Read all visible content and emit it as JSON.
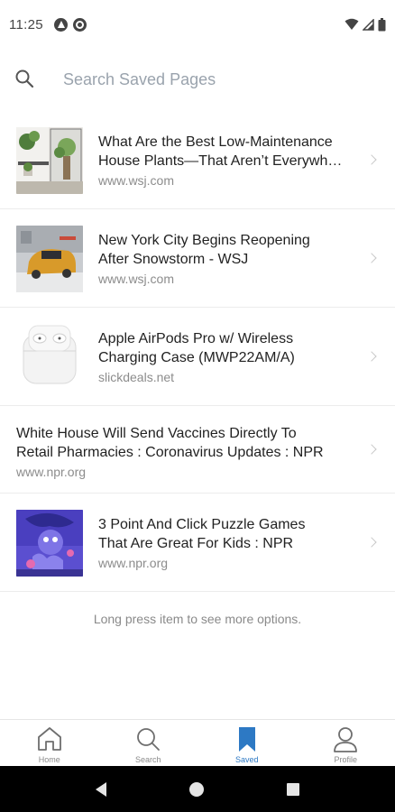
{
  "status_bar": {
    "time": "11:25",
    "left_icons": [
      "app-notification-icon",
      "data-saver-icon"
    ],
    "right_icons": [
      "wifi-icon",
      "signal-icon",
      "battery-icon"
    ]
  },
  "search": {
    "placeholder": "Search Saved Pages",
    "value": ""
  },
  "items": [
    {
      "title": "What Are the Best Low-Maintenance House Plants—That Aren’t Everywh…",
      "title_line1": "What Are the Best Low-Maintenance",
      "title_line2": "House Plants—That Aren’t Everywh…",
      "domain": "www.wsj.com",
      "thumbnail": "house-plants"
    },
    {
      "title": "New York City Begins Reopening After Snowstorm - WSJ",
      "title_line1": "New York City Begins Reopening",
      "title_line2": "After Snowstorm - WSJ",
      "domain": "www.wsj.com",
      "thumbnail": "taxi-snow"
    },
    {
      "title": "Apple AirPods Pro w/ Wireless Charging Case (MWP22AM/A)",
      "title_line1": "Apple AirPods Pro w/ Wireless",
      "title_line2": "Charging Case (MWP22AM/A)",
      "domain": "slickdeals.net",
      "thumbnail": "airpods"
    },
    {
      "title": "White House Will Send Vaccines Directly To Retail Pharmacies : Coronavirus Updates : NPR",
      "title_line1": "White House Will Send Vaccines Directly To",
      "title_line2": "Retail Pharmacies : Coronavirus Updates : NPR",
      "domain": "www.npr.org",
      "thumbnail": null
    },
    {
      "title": "3 Point And Click Puzzle Games That Are Great For Kids : NPR",
      "title_line1": "3 Point And Click Puzzle Games",
      "title_line2": "That Are Great For Kids : NPR",
      "domain": "www.npr.org",
      "thumbnail": "puzzle-game"
    }
  ],
  "hint": "Long press item to see more options.",
  "bottom_nav": [
    {
      "label": "Home",
      "icon": "home-icon",
      "active": false
    },
    {
      "label": "Search",
      "icon": "search-icon",
      "active": false
    },
    {
      "label": "Saved",
      "icon": "bookmark-icon",
      "active": true
    },
    {
      "label": "Profile",
      "icon": "profile-icon",
      "active": false
    }
  ],
  "colors": {
    "accent": "#2d79c4",
    "text_primary": "#222222",
    "text_secondary": "#8c8c8c",
    "placeholder": "#9aa3ad"
  }
}
